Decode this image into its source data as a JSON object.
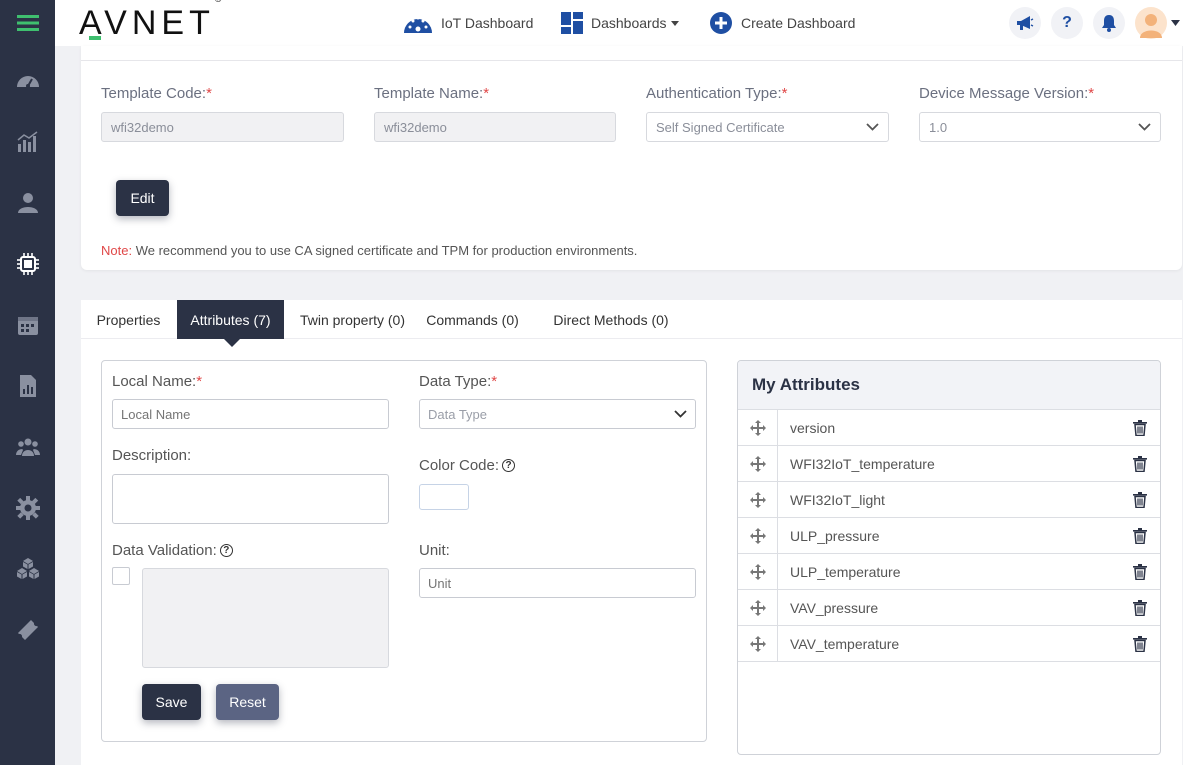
{
  "app": {
    "logo": "AVNET"
  },
  "topnav": {
    "iot_dashboard": "IoT Dashboard",
    "dashboards": "Dashboards",
    "create_dashboard": "Create Dashboard"
  },
  "template": {
    "code_label": "Template Code:",
    "code_value": "wfi32demo",
    "name_label": "Template Name:",
    "name_value": "wfi32demo",
    "auth_label": "Authentication Type:",
    "auth_value": "Self Signed Certificate",
    "msgver_label": "Device Message Version:",
    "msgver_value": "1.0",
    "edit_label": "Edit",
    "note_label": "Note:",
    "note_text": "We recommend you to use CA signed certificate and TPM for production environments."
  },
  "tabs": [
    {
      "label": "Properties"
    },
    {
      "label": "Attributes (7)"
    },
    {
      "label": "Twin property (0)"
    },
    {
      "label": "Commands (0)"
    },
    {
      "label": "Direct Methods (0)"
    }
  ],
  "attr_form": {
    "local_name_label": "Local Name:",
    "local_name_placeholder": "Local Name",
    "data_type_label": "Data Type:",
    "data_type_placeholder": "Data Type",
    "description_label": "Description:",
    "color_code_label": "Color Code:",
    "data_validation_label": "Data Validation:",
    "unit_label": "Unit:",
    "unit_placeholder": "Unit",
    "save_label": "Save",
    "reset_label": "Reset"
  },
  "my_attributes": {
    "title": "My Attributes",
    "items": [
      {
        "name": "version"
      },
      {
        "name": "WFI32IoT_temperature"
      },
      {
        "name": "WFI32IoT_light"
      },
      {
        "name": "ULP_pressure"
      },
      {
        "name": "ULP_temperature"
      },
      {
        "name": "VAV_pressure"
      },
      {
        "name": "VAV_temperature"
      }
    ]
  },
  "colors": {
    "sidebar": "#2b3245",
    "accent_green": "#3fbf6f",
    "required": "#e04848",
    "nav_blue": "#1f4fa3"
  }
}
